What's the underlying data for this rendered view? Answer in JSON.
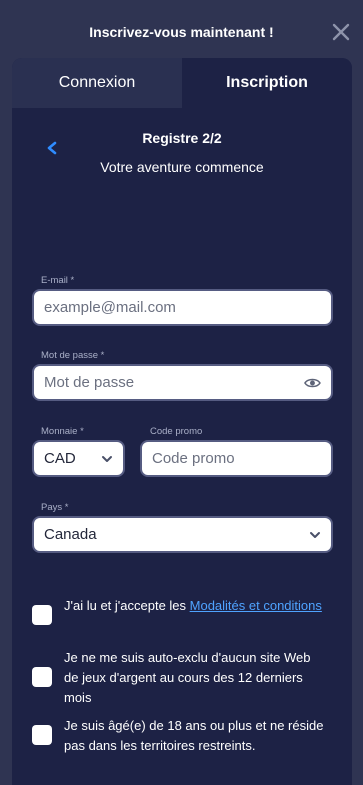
{
  "header": {
    "title": "Inscrivez-vous maintenant !",
    "close_icon": "close-icon"
  },
  "tabs": [
    {
      "label": "Connexion",
      "active": false
    },
    {
      "label": "Inscription",
      "active": true
    }
  ],
  "form": {
    "step": "Registre 2/2",
    "subtitle": "Votre aventure commence",
    "email": {
      "label": "E-mail *",
      "placeholder": "example@mail.com",
      "value": ""
    },
    "password": {
      "label": "Mot de passe *",
      "placeholder": "Mot de passe",
      "value": ""
    },
    "currency": {
      "label": "Monnaie *",
      "value": "CAD"
    },
    "promo": {
      "label": "Code promo",
      "placeholder": "Code promo",
      "value": ""
    },
    "country": {
      "label": "Pays *",
      "value": "Canada"
    }
  },
  "consents": [
    {
      "text_before": "J'ai lu et j'accepte les ",
      "link": "Modalités et conditions",
      "checked": false
    },
    {
      "text": "Je ne me suis auto-exclu d'aucun site Web de jeux d'argent au cours des 12 derniers mois",
      "checked": false
    },
    {
      "text": "Je suis âgé(e) de 18 ans ou plus et ne réside pas dans les territoires restreints.",
      "checked": false
    }
  ],
  "colors": {
    "page_bg": "#2f3452",
    "panel_bg": "#1d2245",
    "inactive_tab_bg": "#2a3051",
    "back_arrow": "#2f8cff",
    "link": "#4fa3ff"
  }
}
